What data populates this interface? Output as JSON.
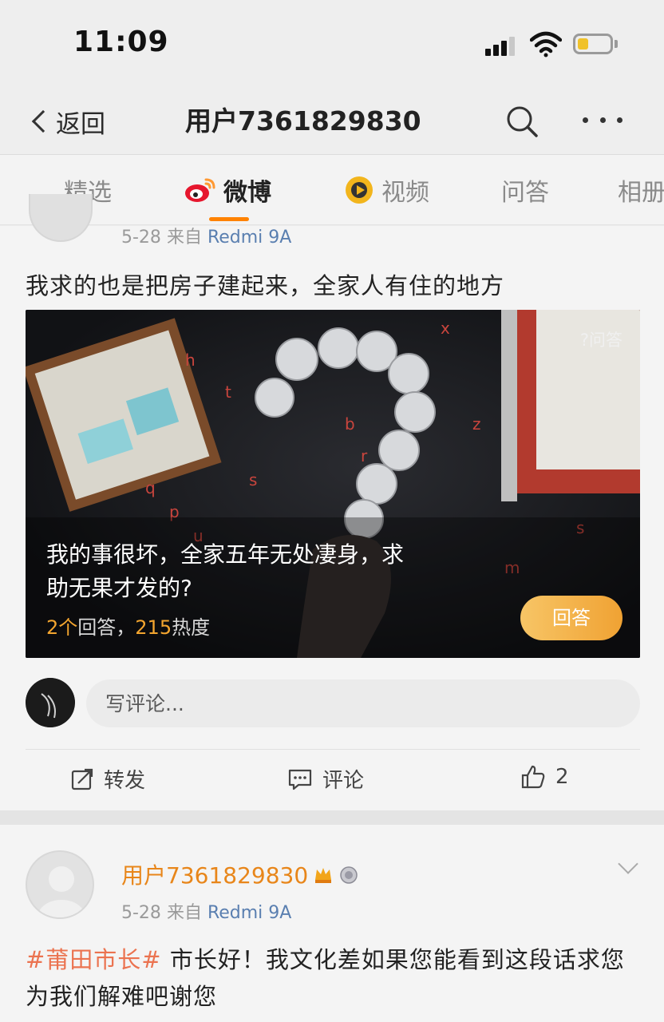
{
  "status_bar": {
    "time": "11:09",
    "battery_level": 0.35,
    "battery_color": "#f0c22a"
  },
  "nav": {
    "back_label": "返回",
    "title": "用户7361829830"
  },
  "tabs": [
    {
      "label": "精选",
      "active": false
    },
    {
      "label": "微博",
      "active": true
    },
    {
      "label": "视频",
      "active": false
    },
    {
      "label": "问答",
      "active": false
    },
    {
      "label": "相册",
      "active": false
    }
  ],
  "accent_color": "#ff8200",
  "post1": {
    "date": "5-28",
    "source_prefix": "来自",
    "source": "Redmi 9A",
    "text": "我求的也是把房子建起来，全家人有住的地方",
    "qa_card": {
      "tag": "?问答",
      "question": "我的事很坏，全家五年无处凄身，求助无果才发的?",
      "stats_count": "2个",
      "stats_mid": "回答，",
      "stats_heat": "215",
      "stats_suffix": "热度",
      "answer_button": "回答"
    },
    "comment_placeholder": "写评论...",
    "actions": {
      "repost": "转发",
      "comment": "评论",
      "like_count": "2"
    }
  },
  "post2": {
    "username": "用户7361829830",
    "date": "5-28",
    "source_prefix": "来自",
    "source": "Redmi 9A",
    "hashtag": "#莆田市长#",
    "text": " 市长好！我文化差如果您能看到这段话求您为我们解难吧谢您"
  }
}
